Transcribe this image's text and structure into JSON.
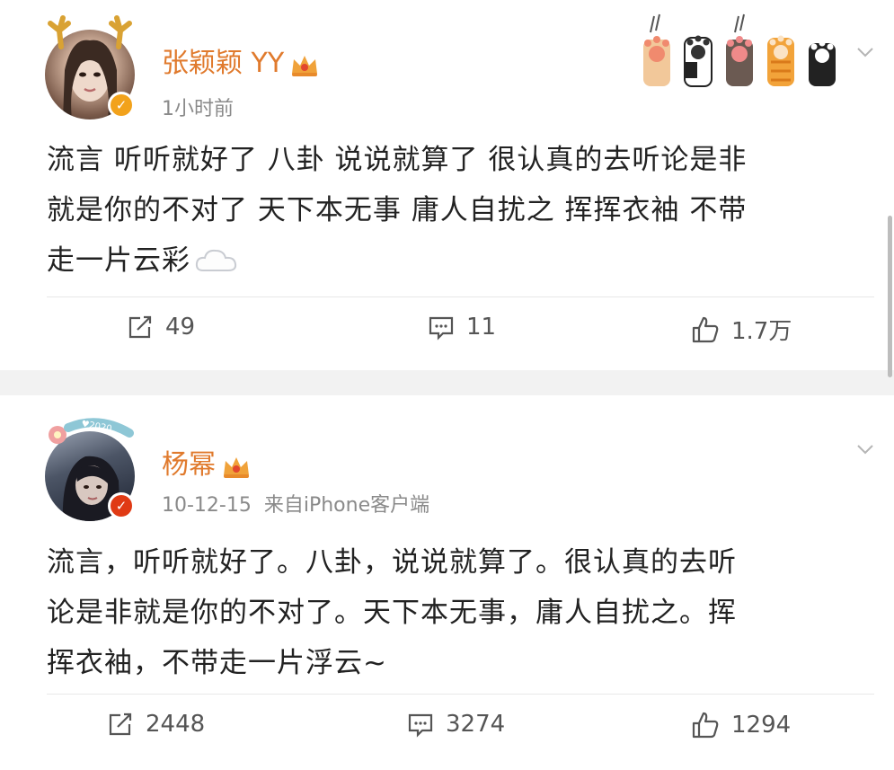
{
  "posts": [
    {
      "author": "张颖颖 YY",
      "time": "1小时前",
      "badge_color": "#f2a21b",
      "content_lines": [
        "流言 听听就好了 八卦 说说就算了 很认真的去听论是非",
        "就是你的不对了 天下本无事 庸人自扰之 挥挥衣袖 不带",
        "走一片云彩"
      ],
      "emoji": "cloud-icon",
      "repost": "49",
      "comment": "11",
      "like": "1.7万"
    },
    {
      "author": "杨幂",
      "time": "10-12-15",
      "source": "来自iPhone客户端",
      "badge_color": "#e03a14",
      "content_lines": [
        "流言，听听就好了。八卦，说说就算了。很认真的去听",
        "论是非就是你的不对了。天下本无事，庸人自扰之。挥",
        "挥衣袖，不带走一片浮云~"
      ],
      "repost": "2448",
      "comment": "3274",
      "like": "1294"
    }
  ],
  "colors": {
    "name": "#e07a2d",
    "meta": "#8a8a8a",
    "text": "#222222"
  }
}
